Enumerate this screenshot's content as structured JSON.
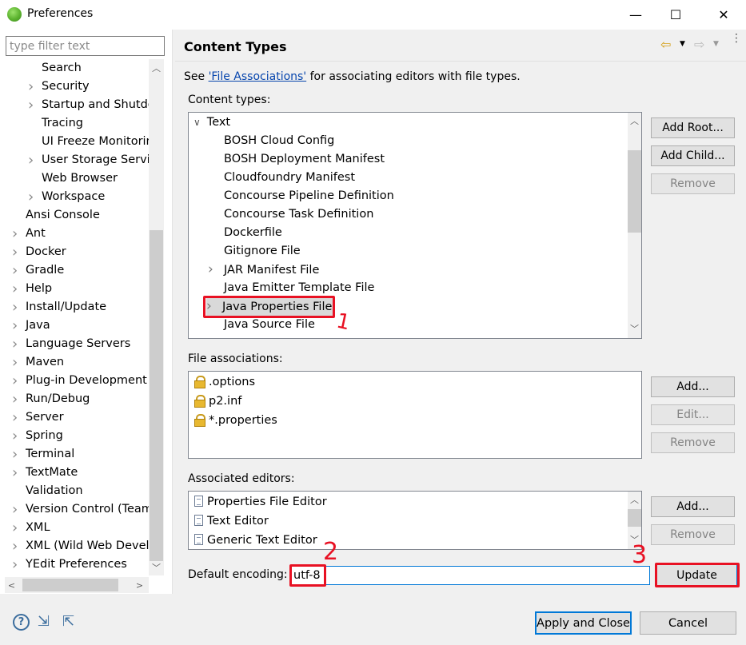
{
  "window": {
    "title": "Preferences",
    "controls": [
      "—",
      "☐",
      "✕"
    ]
  },
  "filter": {
    "placeholder": "type filter text"
  },
  "nav_tree": [
    {
      "label": "Search",
      "level": 2,
      "expandable": false
    },
    {
      "label": "Security",
      "level": 2,
      "expandable": true
    },
    {
      "label": "Startup and Shutdo",
      "level": 2,
      "expandable": true
    },
    {
      "label": "Tracing",
      "level": 2,
      "expandable": false
    },
    {
      "label": "UI Freeze Monitorin",
      "level": 2,
      "expandable": false
    },
    {
      "label": "User Storage Servic",
      "level": 2,
      "expandable": true
    },
    {
      "label": "Web Browser",
      "level": 2,
      "expandable": false
    },
    {
      "label": "Workspace",
      "level": 2,
      "expandable": true
    },
    {
      "label": "Ansi Console",
      "level": 1,
      "expandable": false
    },
    {
      "label": "Ant",
      "level": 1,
      "expandable": true
    },
    {
      "label": "Docker",
      "level": 1,
      "expandable": true
    },
    {
      "label": "Gradle",
      "level": 1,
      "expandable": true
    },
    {
      "label": "Help",
      "level": 1,
      "expandable": true
    },
    {
      "label": "Install/Update",
      "level": 1,
      "expandable": true
    },
    {
      "label": "Java",
      "level": 1,
      "expandable": true
    },
    {
      "label": "Language Servers",
      "level": 1,
      "expandable": true
    },
    {
      "label": "Maven",
      "level": 1,
      "expandable": true
    },
    {
      "label": "Plug-in Development",
      "level": 1,
      "expandable": true
    },
    {
      "label": "Run/Debug",
      "level": 1,
      "expandable": true
    },
    {
      "label": "Server",
      "level": 1,
      "expandable": true
    },
    {
      "label": "Spring",
      "level": 1,
      "expandable": true
    },
    {
      "label": "Terminal",
      "level": 1,
      "expandable": true
    },
    {
      "label": "TextMate",
      "level": 1,
      "expandable": true
    },
    {
      "label": "Validation",
      "level": 1,
      "expandable": false
    },
    {
      "label": "Version Control (Team",
      "level": 1,
      "expandable": true
    },
    {
      "label": "XML",
      "level": 1,
      "expandable": true
    },
    {
      "label": "XML (Wild Web Develo",
      "level": 1,
      "expandable": true
    },
    {
      "label": "YEdit Preferences",
      "level": 1,
      "expandable": true
    }
  ],
  "page": {
    "title": "Content Types",
    "see_prefix": "See ",
    "see_link": "'File Associations'",
    "see_suffix": " for associating editors with file types."
  },
  "content_types": {
    "label": "Content types:",
    "root": "Text",
    "items": [
      {
        "label": "BOSH Cloud Config",
        "expandable": false
      },
      {
        "label": "BOSH Deployment Manifest",
        "expandable": false
      },
      {
        "label": "Cloudfoundry Manifest",
        "expandable": false
      },
      {
        "label": "Concourse Pipeline Definition",
        "expandable": false
      },
      {
        "label": "Concourse Task Definition",
        "expandable": false
      },
      {
        "label": "Dockerfile",
        "expandable": false
      },
      {
        "label": "Gitignore File",
        "expandable": false
      },
      {
        "label": "JAR Manifest File",
        "expandable": true
      },
      {
        "label": "Java Emitter Template File",
        "expandable": false
      },
      {
        "label": "Java Properties File",
        "expandable": true,
        "selected": true
      },
      {
        "label": "Java Source File",
        "expandable": false
      }
    ],
    "buttons": {
      "add_root": "Add Root...",
      "add_child": "Add Child...",
      "remove": "Remove"
    }
  },
  "file_associations": {
    "label": "File associations:",
    "items": [
      ".options",
      "p2.inf",
      "*.properties"
    ],
    "buttons": {
      "add": "Add...",
      "edit": "Edit...",
      "remove": "Remove"
    }
  },
  "associated_editors": {
    "label": "Associated editors:",
    "items": [
      "Properties File Editor",
      "Text Editor",
      "Generic Text Editor"
    ],
    "buttons": {
      "add": "Add...",
      "remove": "Remove"
    }
  },
  "encoding": {
    "label": "Default encoding:",
    "value": "utf-8",
    "update": "Update"
  },
  "footer": {
    "apply_close": "Apply and Close",
    "cancel": "Cancel"
  },
  "annotations": [
    "1",
    "2",
    "3"
  ],
  "colors": {
    "annotation": "#e81123",
    "link": "#0645ad",
    "selection": "#d9d9d9"
  }
}
